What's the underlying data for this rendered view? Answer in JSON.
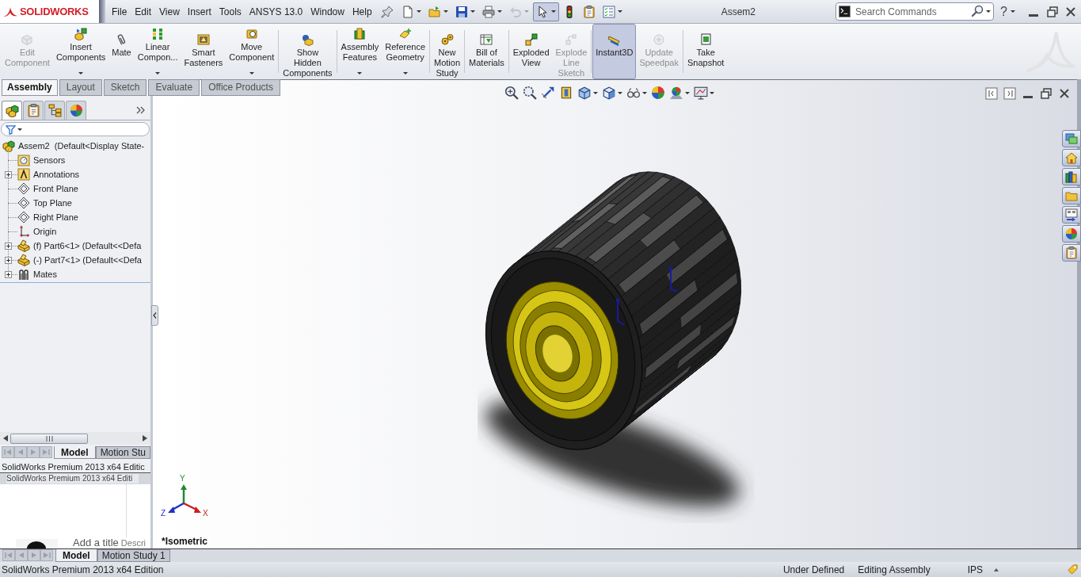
{
  "logo": {
    "text": "SOLIDWORKS"
  },
  "menu": [
    "File",
    "Edit",
    "View",
    "Insert",
    "Tools",
    "ANSYS 13.0",
    "Window",
    "Help"
  ],
  "quick_access": [
    {
      "kind": "new",
      "dropdown": true,
      "disabled": false,
      "selected": false
    },
    {
      "kind": "open",
      "dropdown": true,
      "disabled": false,
      "selected": false
    },
    {
      "kind": "save",
      "dropdown": true,
      "disabled": false,
      "selected": false
    },
    {
      "kind": "print",
      "dropdown": true,
      "disabled": false,
      "selected": false
    },
    {
      "kind": "undo",
      "dropdown": true,
      "disabled": true,
      "selected": false
    },
    {
      "kind": "select",
      "dropdown": true,
      "disabled": false,
      "selected": true
    },
    {
      "kind": "rebuild",
      "dropdown": false,
      "disabled": false,
      "selected": false
    },
    {
      "kind": "options",
      "dropdown": false,
      "disabled": false,
      "selected": false
    },
    {
      "kind": "customize",
      "dropdown": true,
      "disabled": false,
      "selected": false
    }
  ],
  "document_title": "Assem2",
  "search": {
    "placeholder": "Search Commands"
  },
  "help": "?",
  "command_manager": {
    "groups": [
      {
        "buttons": [
          {
            "label": "Edit Component",
            "disabled": true,
            "dropdown": false,
            "selected": false
          },
          {
            "label": "Insert Components",
            "disabled": false,
            "dropdown": true,
            "selected": false
          },
          {
            "label": "Mate",
            "disabled": false,
            "dropdown": false,
            "selected": false
          },
          {
            "label": "Linear Compon...",
            "disabled": false,
            "dropdown": true,
            "selected": false
          },
          {
            "label": "Smart Fasteners",
            "disabled": false,
            "dropdown": false,
            "selected": false
          },
          {
            "label": "Move Component",
            "disabled": false,
            "dropdown": true,
            "selected": false
          }
        ]
      },
      {
        "buttons": [
          {
            "label": "Show Hidden Components",
            "disabled": false,
            "dropdown": false,
            "selected": false
          }
        ]
      },
      {
        "buttons": [
          {
            "label": "Assembly Features",
            "disabled": false,
            "dropdown": true,
            "selected": false
          },
          {
            "label": "Reference Geometry",
            "disabled": false,
            "dropdown": true,
            "selected": false
          }
        ]
      },
      {
        "buttons": [
          {
            "label": "New Motion Study",
            "disabled": false,
            "dropdown": false,
            "selected": false
          }
        ]
      },
      {
        "buttons": [
          {
            "label": "Bill of Materials",
            "disabled": false,
            "dropdown": false,
            "selected": false
          }
        ]
      },
      {
        "buttons": [
          {
            "label": "Exploded View",
            "disabled": false,
            "dropdown": false,
            "selected": false
          },
          {
            "label": "Explode Line Sketch",
            "disabled": true,
            "dropdown": false,
            "selected": false
          }
        ]
      },
      {
        "buttons": [
          {
            "label": "Instant3D",
            "disabled": false,
            "dropdown": false,
            "selected": true
          },
          {
            "label": "Update Speedpak",
            "disabled": true,
            "dropdown": false,
            "selected": false
          }
        ]
      },
      {
        "buttons": [
          {
            "label": "Take Snapshot",
            "disabled": false,
            "dropdown": false,
            "selected": false
          }
        ]
      }
    ]
  },
  "tabs": [
    {
      "label": "Assembly",
      "selected": true
    },
    {
      "label": "Layout",
      "selected": false
    },
    {
      "label": "Sketch",
      "selected": false
    },
    {
      "label": "Evaluate",
      "selected": false
    },
    {
      "label": "Office Products",
      "selected": false
    }
  ],
  "feature_manager": {
    "tabs": [
      {
        "selected": true
      },
      {
        "selected": false
      },
      {
        "selected": false
      },
      {
        "selected": false
      }
    ],
    "tree": {
      "label": "Assem2  (Default<Display State-",
      "kind": "assembly",
      "children": [
        {
          "label": "Sensors",
          "kind": "sensors"
        },
        {
          "label": "Annotations",
          "kind": "annotations",
          "expanded": false
        },
        {
          "label": "Front Plane",
          "kind": "plane"
        },
        {
          "label": "Top Plane",
          "kind": "plane"
        },
        {
          "label": "Right Plane",
          "kind": "plane"
        },
        {
          "label": "Origin",
          "kind": "origin"
        },
        {
          "label": "(f) Part6<1> (Default<<Defa",
          "kind": "part",
          "expanded": false
        },
        {
          "label": "(-) Part7<1> (Default<<Defa",
          "kind": "part",
          "expanded": false
        },
        {
          "label": "Mates",
          "kind": "mates",
          "expanded": false
        }
      ]
    },
    "model_tabs": [
      {
        "label": "Model",
        "selected": true
      },
      {
        "label": "Motion Stu",
        "selected": false
      }
    ],
    "edition_text": "SolidWorks Premium 2013 x64 Editic",
    "edition_text_repeat": "SolidWorks Premium 2013 x64 Editi",
    "title_prompt": "Add a title",
    "description_prompt": "Descri"
  },
  "viewport": {
    "heads_up_toolbar": [
      {
        "kind": "zoomfit",
        "dropdown": false
      },
      {
        "kind": "zoomarea",
        "dropdown": false
      },
      {
        "kind": "previous",
        "dropdown": false
      },
      {
        "kind": "section",
        "dropdown": false
      },
      {
        "kind": "orientation",
        "dropdown": true
      },
      {
        "kind": "display",
        "dropdown": true
      },
      {
        "kind": "visibility",
        "dropdown": true
      },
      {
        "kind": "appearance",
        "dropdown": false
      },
      {
        "kind": "scene",
        "dropdown": true
      },
      {
        "kind": "settings",
        "dropdown": true
      }
    ],
    "triad": {
      "y": "Y",
      "z": "Z",
      "x": "X"
    },
    "orientation": "*Isometric"
  },
  "bottom_tabs": [
    {
      "label": "Model",
      "selected": true
    },
    {
      "label": "Motion Study 1",
      "selected": false
    }
  ],
  "status_bar": {
    "edition": "SolidWorks Premium 2013 x64 Edition",
    "definition": "Under Defined",
    "mode": "Editing Assembly",
    "units": "IPS"
  }
}
